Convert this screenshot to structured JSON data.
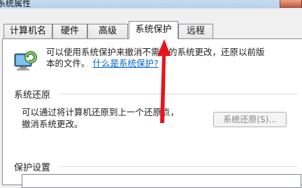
{
  "window": {
    "title": "系统属性"
  },
  "tabs": [
    {
      "label": "计算机名"
    },
    {
      "label": "硬件"
    },
    {
      "label": "高级"
    },
    {
      "label": "系统保护"
    },
    {
      "label": "远程"
    }
  ],
  "active_tab": "系统保护",
  "protection": {
    "description_line1": "可以使用系统保护来撤消不需要的系统更改，还原以前版",
    "description_line2": "本的文件。",
    "link": "什么是系统保护?"
  },
  "restore": {
    "group_title": "系统还原",
    "text_line1": "可以通过将计算机还原到上一个还原点，",
    "text_line2": "撤消系统更改。",
    "button_label": "系统还原(S)..."
  },
  "settings": {
    "group_title": "保护设置"
  },
  "colors": {
    "arrow": "#e8141b",
    "link": "#0066cc",
    "tab_border": "#898c95"
  }
}
